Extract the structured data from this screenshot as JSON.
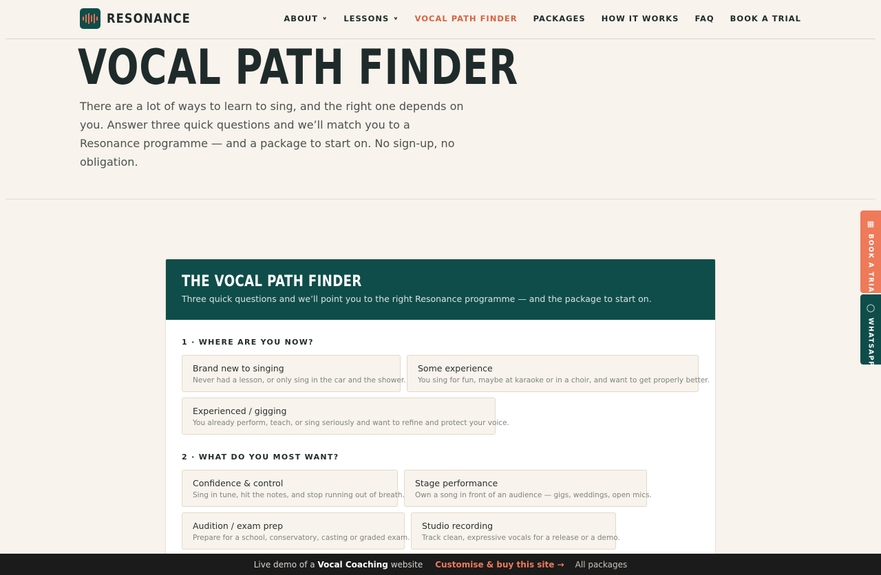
{
  "brand": {
    "name": "RESONANCE",
    "icon": "soundwave-icon",
    "accent": "#ec6e4c",
    "primary": "#0f4d4a"
  },
  "nav": {
    "items": [
      {
        "label": "ABOUT",
        "dropdown": true
      },
      {
        "label": "LESSONS",
        "dropdown": true
      },
      {
        "label": "VOCAL PATH FINDER",
        "active": true
      },
      {
        "label": "PACKAGES"
      },
      {
        "label": "HOW IT WORKS"
      },
      {
        "label": "FAQ"
      },
      {
        "label": "BOOK A TRIAL"
      }
    ]
  },
  "hero": {
    "title": "VOCAL PATH FINDER",
    "lead": "There are a lot of ways to learn to sing, and the right one depends on you. Answer three quick questions and we’ll match you to a Resonance programme — and a package to start on. No sign-up, no obligation."
  },
  "side_tabs": {
    "trial": {
      "label": "BOOK A TRIAL",
      "icon": "calendar-icon"
    },
    "whatsapp": {
      "label": "WHATSAPP",
      "icon": "chat-bubble-icon"
    }
  },
  "finder": {
    "title": "THE VOCAL PATH FINDER",
    "subtitle": "Three quick questions and we’ll point you to the right Resonance programme — and the package to start on.",
    "questions": [
      {
        "label": "1 · WHERE ARE YOU NOW?",
        "options": [
          {
            "title": "Brand new to singing",
            "desc": "Never had a lesson, or only sing in the car and the shower."
          },
          {
            "title": "Some experience",
            "desc": "You sing for fun, maybe at karaoke or in a choir, and want to get properly better."
          },
          {
            "title": "Experienced / gigging",
            "desc": "You already perform, teach, or sing seriously and want to refine and protect your voice."
          }
        ]
      },
      {
        "label": "2 · WHAT DO YOU MOST WANT?",
        "options": [
          {
            "title": "Confidence & control",
            "desc": "Sing in tune, hit the notes, and stop running out of breath."
          },
          {
            "title": "Stage performance",
            "desc": "Own a song in front of an audience — gigs, weddings, open mics."
          },
          {
            "title": "Audition / exam prep",
            "desc": "Prepare for a school, conservatory, casting or graded exam."
          },
          {
            "title": "Studio recording",
            "desc": "Track clean, expressive vocals for a release or a demo."
          }
        ]
      }
    ]
  },
  "demo_bar": {
    "prefix": "Live demo of a",
    "site_type": "Vocal Coaching",
    "suffix": "website",
    "cta": "Customise & buy this site →",
    "all": "All packages"
  }
}
